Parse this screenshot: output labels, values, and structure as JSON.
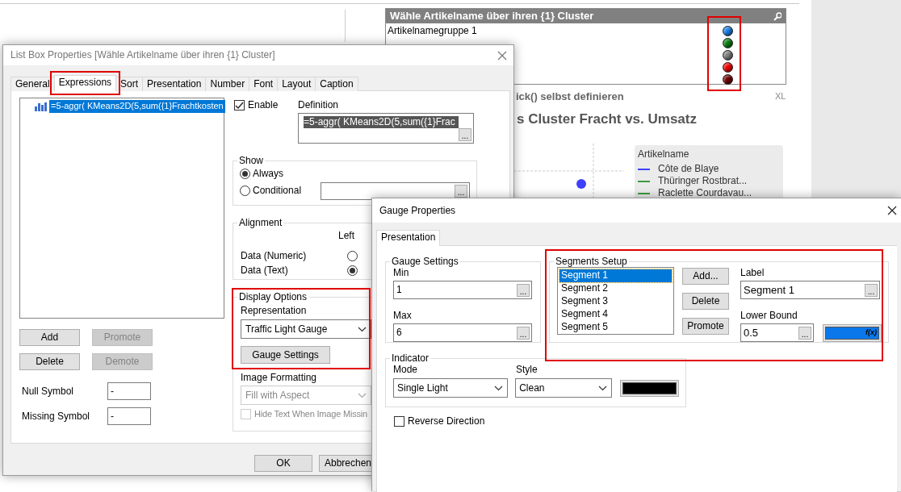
{
  "sheet": {
    "listbox": {
      "title": "Wähle Artikelname über ihren {1} Cluster",
      "rows": [
        {
          "label": "Artikelnamegruppe 1",
          "color": "#1a7fe8"
        },
        {
          "color": "#0b7d12"
        },
        {
          "color": "#7f7f7f"
        },
        {
          "color": "#f00000"
        },
        {
          "color": "#700000"
        }
      ],
      "lights_highlighted": true
    },
    "caption": "ick() selbst definieren",
    "caption_badge": "XL",
    "chart_title": "s Cluster Fracht vs. Umsatz",
    "legend": {
      "title": "Artikelname",
      "items": [
        {
          "label": "Côte de Blaye",
          "color": "#4040ff"
        },
        {
          "label": "Thüringer Rostbrat...",
          "color": "#3a9a3a"
        },
        {
          "label": "Raclette Courdavau...",
          "color": "#3a9a3a"
        }
      ]
    }
  },
  "list_dialog": {
    "title": "List Box Properties [Wähle Artikelname über ihren {1} Cluster]",
    "tabs": [
      {
        "label": "General",
        "selected": false,
        "highlighted": false
      },
      {
        "label": "Expressions",
        "selected": true,
        "highlighted": true
      },
      {
        "label": "Sort",
        "selected": false,
        "highlighted": false
      },
      {
        "label": "Presentation",
        "selected": false,
        "highlighted": false
      },
      {
        "label": "Number",
        "selected": false,
        "highlighted": false
      },
      {
        "label": "Font",
        "selected": false,
        "highlighted": false
      },
      {
        "label": "Layout",
        "selected": false,
        "highlighted": false
      },
      {
        "label": "Caption",
        "selected": false,
        "highlighted": false
      }
    ],
    "expressions": [
      {
        "text": "=5-aggr( KMeans2D(5,sum({1}Frachtkosten",
        "selected": true
      }
    ],
    "buttons": [
      {
        "label": "Add",
        "disabled": false
      },
      {
        "label": "Promote",
        "disabled": true
      },
      {
        "label": "Delete",
        "disabled": false
      },
      {
        "label": "Demote",
        "disabled": true
      }
    ],
    "symbols": [
      {
        "label": "Null Symbol",
        "value": "-"
      },
      {
        "label": "Missing Symbol",
        "value": "-"
      }
    ],
    "enable": {
      "label": "Enable",
      "checked": true
    },
    "definition": {
      "label": "Definition",
      "value": "=5-aggr( KMeans2D(5,sum({1}Frac",
      "browse": "..."
    },
    "show": {
      "title": "Show",
      "options": [
        {
          "label": "Always",
          "selected": true
        },
        {
          "label": "Conditional",
          "selected": false
        }
      ],
      "browse": "..."
    },
    "alignment": {
      "title": "Alignment",
      "column": "Left",
      "rows": [
        {
          "label": "Data (Numeric)",
          "selected": false
        },
        {
          "label": "Data (Text)",
          "selected": true
        }
      ]
    },
    "display_options": {
      "title": "Display Options",
      "highlighted": true,
      "representation_label": "Representation",
      "representation": "Traffic Light Gauge",
      "button": "Gauge Settings"
    },
    "image_formatting": {
      "label": "Image Formatting",
      "value": "Fill with Aspect",
      "disabled": true,
      "hide_text": {
        "label": "Hide Text When Image Missin",
        "checked": false
      }
    },
    "footer_buttons": [
      "OK",
      "Abbrechen"
    ]
  },
  "gauge_dialog": {
    "title": "Gauge Properties",
    "tabs": [
      {
        "label": "Presentation",
        "selected": true
      }
    ],
    "settings": {
      "title": "Gauge Settings",
      "fields": [
        {
          "label": "Min",
          "value": "1",
          "browse": "..."
        },
        {
          "label": "Max",
          "value": "6",
          "browse": "..."
        }
      ]
    },
    "segments": {
      "title": "Segments Setup",
      "highlighted": true,
      "items": [
        {
          "label": "Segment 1",
          "selected": true
        },
        {
          "label": "Segment 2",
          "selected": false
        },
        {
          "label": "Segment 3",
          "selected": false
        },
        {
          "label": "Segment 4",
          "selected": false
        },
        {
          "label": "Segment 5",
          "selected": false
        }
      ],
      "buttons": [
        "Add...",
        "Delete",
        "Promote"
      ],
      "label_caption": "Label",
      "label": "Segment 1",
      "label_browse": "...",
      "lower_bound_caption": "Lower Bound",
      "lower_bound": "0.5",
      "lower_bound_browse": "...",
      "color": "#0a78ea",
      "color_fx": "f(x)"
    },
    "indicator": {
      "title": "Indicator",
      "mode_label": "Mode",
      "mode": "Single Light",
      "style_label": "Style",
      "style": "Clean",
      "color": "#000000"
    },
    "reverse": {
      "label": "Reverse Direction",
      "checked": false
    }
  }
}
